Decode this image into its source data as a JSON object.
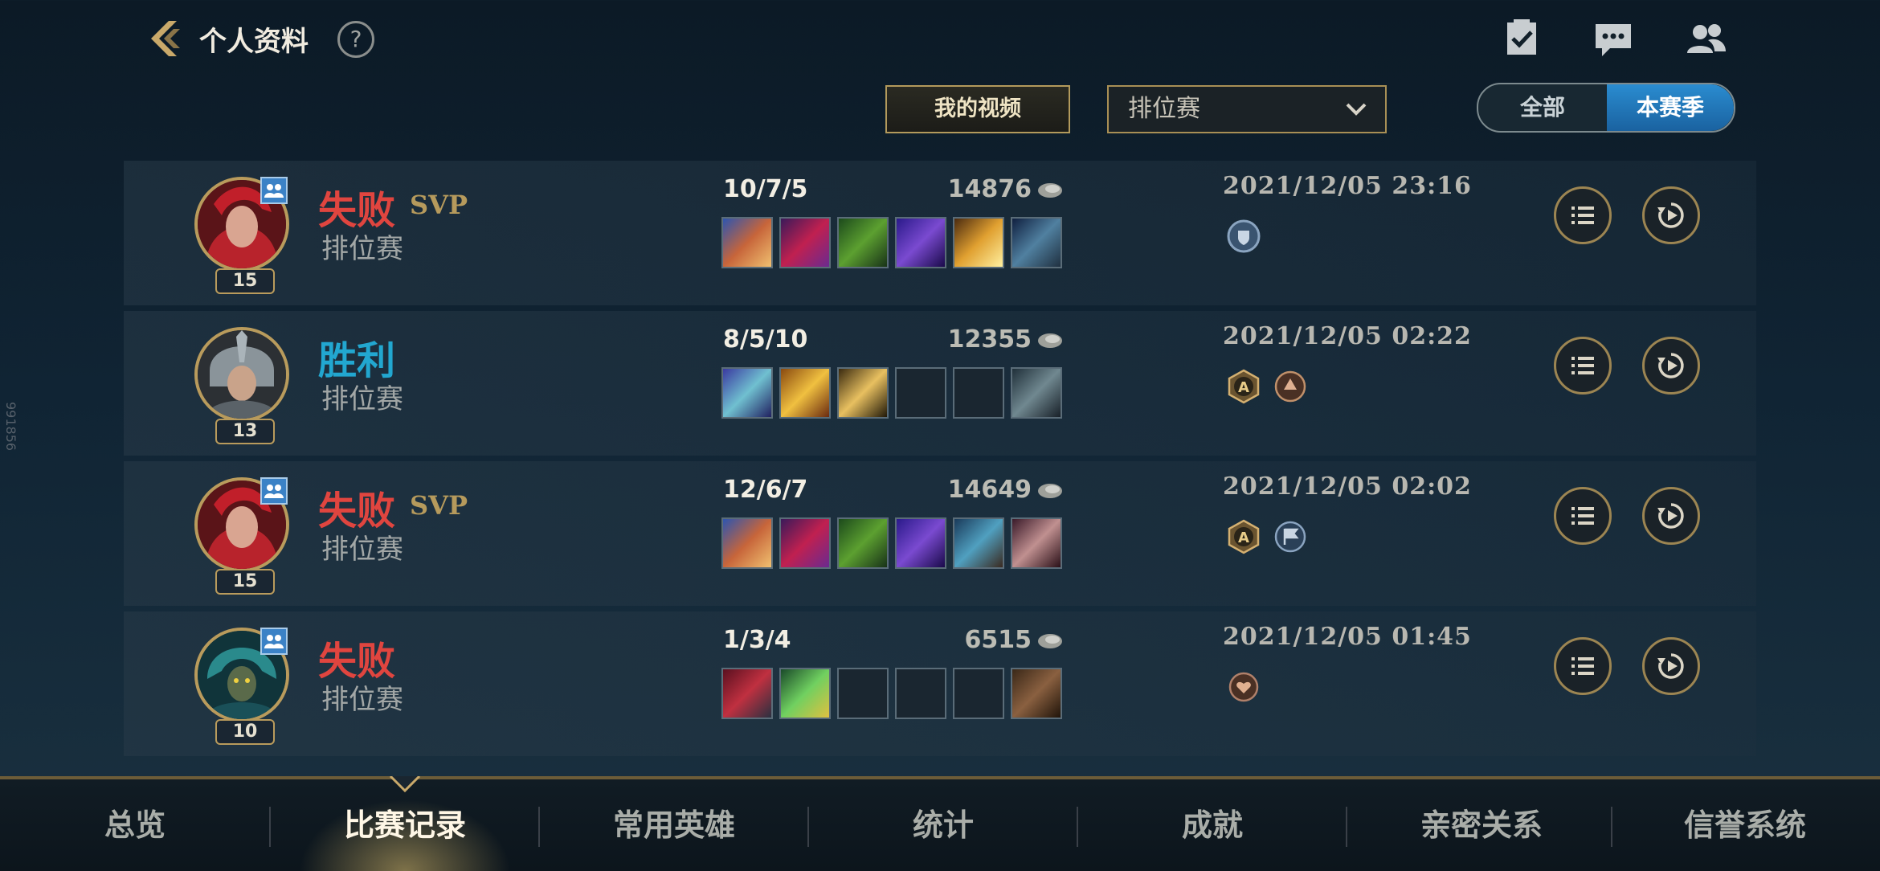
{
  "header": {
    "title": "个人资料",
    "help_label": "?",
    "icons": [
      "back-icon",
      "tasks-icon",
      "chat-icon",
      "friends-icon"
    ]
  },
  "filters": {
    "video_button": "我的视频",
    "mode_select": "排位赛",
    "scope_all": "全部",
    "scope_season": "本赛季",
    "scope_selected": "本赛季"
  },
  "side_mark": "991856",
  "matches": [
    {
      "result": "失败",
      "svp": "SVP",
      "mode": "排位赛",
      "level": "15",
      "kda": "10/7/5",
      "gold": "14876",
      "date": "2021/12/05 23:16",
      "party": true
    },
    {
      "result": "胜利",
      "svp": "",
      "mode": "排位赛",
      "level": "13",
      "kda": "8/5/10",
      "gold": "12355",
      "date": "2021/12/05 02:22",
      "party": false
    },
    {
      "result": "失败",
      "svp": "SVP",
      "mode": "排位赛",
      "level": "15",
      "kda": "12/6/7",
      "gold": "14649",
      "date": "2021/12/05 02:02",
      "party": true
    },
    {
      "result": "失败",
      "svp": "",
      "mode": "排位赛",
      "level": "10",
      "kda": "1/3/4",
      "gold": "6515",
      "date": "2021/12/05 01:45",
      "party": true
    }
  ],
  "tabs": [
    "总览",
    "比赛记录",
    "常用英雄",
    "统计",
    "成就",
    "亲密关系",
    "信誉系统"
  ],
  "active_tab": "比赛记录",
  "colors": {
    "lose": "#e0453f",
    "win": "#22a7d0",
    "gold_accent": "#b99b5c",
    "active_segment": "#2a8cd0"
  }
}
